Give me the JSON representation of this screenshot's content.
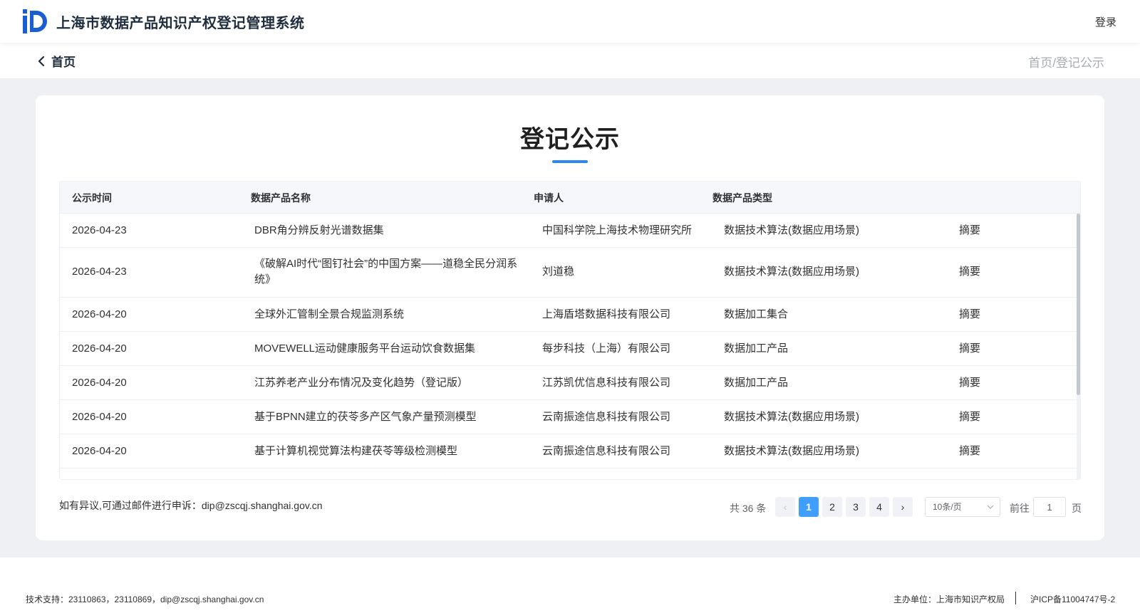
{
  "header": {
    "system_title": "上海市数据产品知识产权登记管理系统",
    "login_label": "登录"
  },
  "subnav": {
    "back_label": "首页",
    "breadcrumb": "首页/登记公示"
  },
  "page": {
    "title": "登记公示"
  },
  "table": {
    "columns": [
      "公示时间",
      "数据产品名称",
      "申请人",
      "数据产品类型"
    ],
    "rows": [
      {
        "date": "2026-04-23",
        "name": "DBR角分辨反射光谱数据集",
        "applicant": "中国科学院上海技术物理研究所",
        "type": "数据技术算法(数据应用场景)",
        "action": "摘要"
      },
      {
        "date": "2026-04-23",
        "name": "《破解AI时代“图钉社会”的中国方案——道稳全民分润系统》",
        "applicant": "刘道稳",
        "type": "数据技术算法(数据应用场景)",
        "action": "摘要"
      },
      {
        "date": "2026-04-20",
        "name": "全球外汇管制全景合规监测系统",
        "applicant": "上海盾塔数据科技有限公司",
        "type": "数据加工集合",
        "action": "摘要"
      },
      {
        "date": "2026-04-20",
        "name": "MOVEWELL运动健康服务平台运动饮食数据集",
        "applicant": "每步科技（上海）有限公司",
        "type": "数据加工产品",
        "action": "摘要"
      },
      {
        "date": "2026-04-20",
        "name": "江苏养老产业分布情况及变化趋势（登记版）",
        "applicant": "江苏凯优信息科技有限公司",
        "type": "数据加工产品",
        "action": "摘要"
      },
      {
        "date": "2026-04-20",
        "name": "基于BPNN建立的茯苓多产区气象产量预测模型",
        "applicant": "云南振途信息科技有限公司",
        "type": "数据技术算法(数据应用场景)",
        "action": "摘要"
      },
      {
        "date": "2026-04-20",
        "name": "基于计算机视觉算法构建茯苓等级检测模型",
        "applicant": "云南振途信息科技有限公司",
        "type": "数据技术算法(数据应用场景)",
        "action": "摘要"
      }
    ]
  },
  "complaint_text": "如有异议,可通过邮件进行申诉：dip@zscqj.shanghai.gov.cn",
  "pagination": {
    "total_text": "共 36 条",
    "prev": "‹",
    "next": "›",
    "pages": [
      "1",
      "2",
      "3",
      "4"
    ],
    "current": "1",
    "page_size": "10条/页",
    "goto_label": "前往",
    "goto_value": "1",
    "page_unit": "页"
  },
  "footer": {
    "tech_support": "技术支持：23110863，23110869，dip@zscqj.shanghai.gov.cn",
    "host": "主办单位：上海市知识产权局",
    "icp": "沪ICP备11004747号-2"
  },
  "colors": {
    "accent": "#409eff",
    "title_underline": "#2e86f0",
    "logo": "#1a5fd1"
  }
}
